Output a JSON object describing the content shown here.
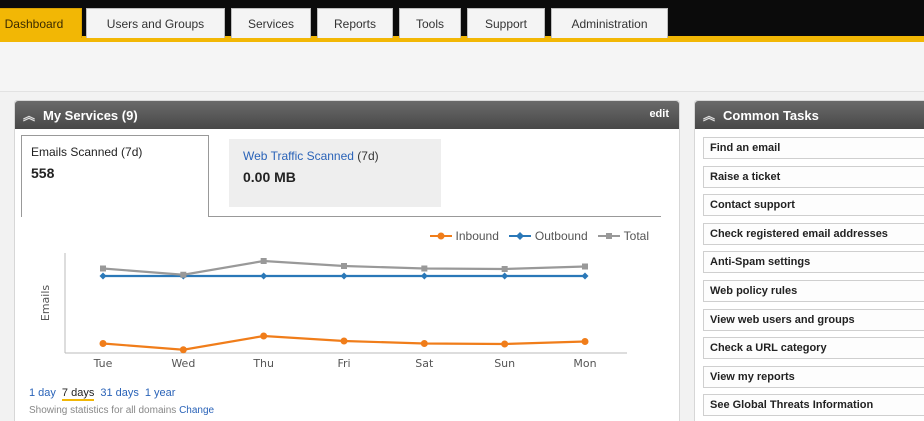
{
  "nav": {
    "tabs": [
      {
        "label": "Dashboard",
        "active": true
      },
      {
        "label": "Users and Groups",
        "active": false
      },
      {
        "label": "Services",
        "active": false
      },
      {
        "label": "Reports",
        "active": false
      },
      {
        "label": "Tools",
        "active": false
      },
      {
        "label": "Support",
        "active": false
      },
      {
        "label": "Administration",
        "active": false
      }
    ]
  },
  "services_panel": {
    "title": "My Services",
    "count": "(9)",
    "edit_label": "edit",
    "collapse_icon": "chevrons-up-icon",
    "emails_scanned": {
      "label": "Emails Scanned (7d)",
      "value": "558"
    },
    "web_traffic": {
      "label": "Web Traffic Scanned",
      "label_suffix": " (7d)",
      "value": "0.00 MB"
    },
    "range_links": [
      "1 day",
      "7 days",
      "31 days",
      "1 year"
    ],
    "active_range": "7 days",
    "footnote_text": "Showing statistics for all domains",
    "footnote_link": "Change"
  },
  "chart_data": {
    "type": "line",
    "categories": [
      "Tue",
      "Wed",
      "Thu",
      "Fri",
      "Sat",
      "Sun",
      "Mon"
    ],
    "ylabel": "Emails",
    "series": [
      {
        "name": "Inbound",
        "color": "#f07d1a",
        "values": [
          30,
          5,
          60,
          40,
          30,
          28,
          38
        ]
      },
      {
        "name": "Outbound",
        "color": "#2a78b8",
        "values": [
          300,
          300,
          300,
          300,
          300,
          300,
          300
        ]
      },
      {
        "name": "Total",
        "color": "#999999",
        "values": [
          330,
          305,
          360,
          340,
          330,
          328,
          338
        ]
      }
    ],
    "ylim": [
      0,
      400
    ],
    "grid": false,
    "legend": "top-right"
  },
  "tasks_panel": {
    "title": "Common Tasks",
    "collapse_icon": "chevrons-up-icon",
    "items": [
      "Find an email",
      "Raise a ticket",
      "Contact support",
      "Check registered email addresses",
      "Anti-Spam settings",
      "Web policy rules",
      "View web users and groups",
      "Check a URL category",
      "View my reports",
      "See Global Threats Information"
    ]
  }
}
